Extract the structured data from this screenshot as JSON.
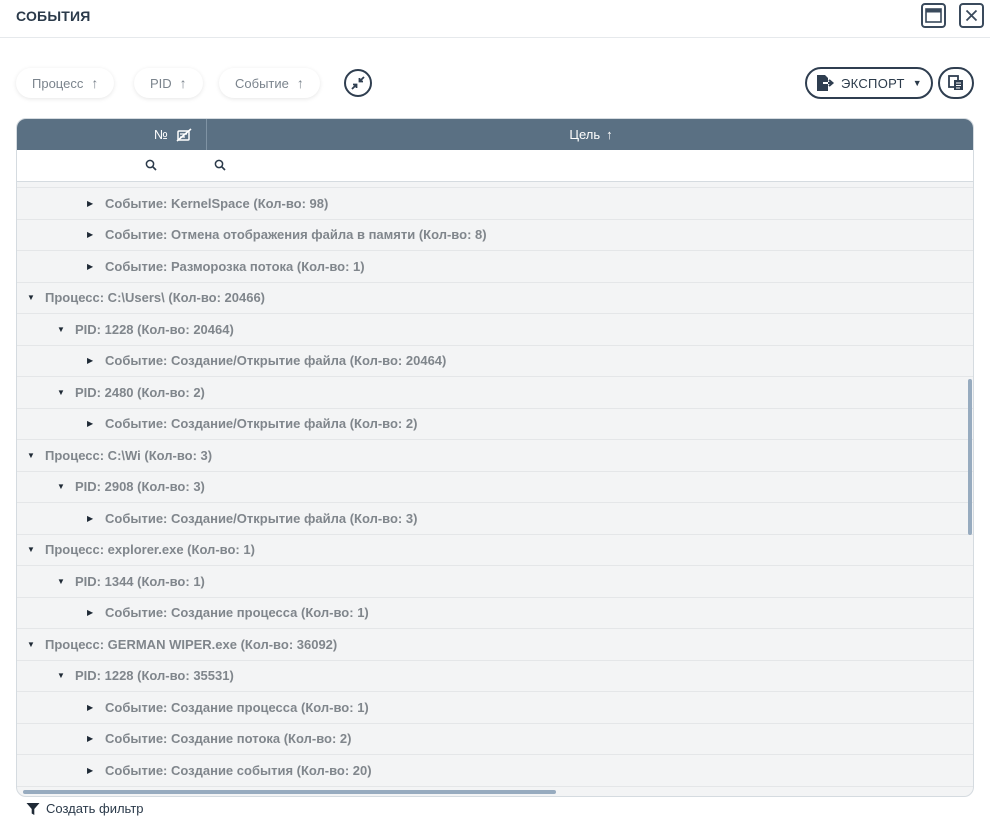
{
  "window": {
    "title": "СОБЫТИЯ",
    "maximize_icon": "window-maximize-icon",
    "close_icon": "close-icon"
  },
  "toolbar": {
    "group_chips": [
      {
        "label": "Процесс",
        "sort": "↑"
      },
      {
        "label": "PID",
        "sort": "↑"
      },
      {
        "label": "Событие",
        "sort": "↑"
      }
    ],
    "collapse_icon": "collapse-arrows-icon",
    "export_label": "ЭКСПОРТ",
    "export_caret": "▼",
    "copy_icon": "copy-icon"
  },
  "grid": {
    "columns": {
      "no": "№",
      "target": "Цель",
      "target_sort": "↑"
    },
    "rows": [
      {
        "level": 2,
        "expanded": false,
        "text": "Событие: KernelSpace (Кол-во: 98)"
      },
      {
        "level": 2,
        "expanded": false,
        "text": "Событие: Отмена отображения файла в памяти (Кол-во: 8)"
      },
      {
        "level": 2,
        "expanded": false,
        "text": "Событие: Разморозка потока (Кол-во: 1)"
      },
      {
        "level": 0,
        "expanded": true,
        "text": "Процесс: C:\\Users\\ (Кол-во: 20466)"
      },
      {
        "level": 1,
        "expanded": true,
        "text": "PID: 1228 (Кол-во: 20464)"
      },
      {
        "level": 2,
        "expanded": false,
        "text": "Событие: Создание/Открытие файла (Кол-во: 20464)"
      },
      {
        "level": 1,
        "expanded": true,
        "text": "PID: 2480 (Кол-во: 2)"
      },
      {
        "level": 2,
        "expanded": false,
        "text": "Событие: Создание/Открытие файла (Кол-во: 2)"
      },
      {
        "level": 0,
        "expanded": true,
        "text": "Процесс: C:\\Wi (Кол-во: 3)"
      },
      {
        "level": 1,
        "expanded": true,
        "text": "PID: 2908 (Кол-во: 3)"
      },
      {
        "level": 2,
        "expanded": false,
        "text": "Событие: Создание/Открытие файла (Кол-во: 3)"
      },
      {
        "level": 0,
        "expanded": true,
        "text": "Процесс: explorer.exe (Кол-во: 1)"
      },
      {
        "level": 1,
        "expanded": true,
        "text": "PID: 1344 (Кол-во: 1)"
      },
      {
        "level": 2,
        "expanded": false,
        "text": "Событие: Создание процесса (Кол-во: 1)"
      },
      {
        "level": 0,
        "expanded": true,
        "text": "Процесс: GERMAN WIPER.exe (Кол-во: 36092)"
      },
      {
        "level": 1,
        "expanded": true,
        "text": "PID: 1228 (Кол-во: 35531)"
      },
      {
        "level": 2,
        "expanded": false,
        "text": "Событие: Создание процесса (Кол-во: 1)"
      },
      {
        "level": 2,
        "expanded": false,
        "text": "Событие: Создание потока (Кол-во: 2)"
      },
      {
        "level": 2,
        "expanded": false,
        "text": "Событие: Создание события (Кол-во: 20)"
      }
    ]
  },
  "footer": {
    "create_filter_label": "Создать фильтр",
    "filter_icon": "funnel-icon"
  },
  "colors": {
    "header_bg": "#5a7083",
    "accent_dark": "#2f3e50",
    "row_bg": "#f3f4f5",
    "row_text": "#80868c",
    "scrollbar": "#97abbf"
  }
}
